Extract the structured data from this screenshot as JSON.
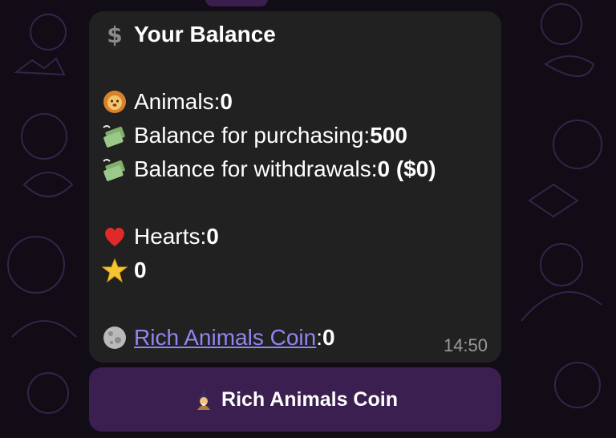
{
  "message": {
    "title": "Your Balance",
    "title_icon": "dollar-sign-icon",
    "animals_label": "Animals: ",
    "animals_value": "0",
    "animals_icon": "lion-face-icon",
    "purchase_label": "Balance for purchasing: ",
    "purchase_value": "500",
    "purchase_icon": "flying-money-icon",
    "withdraw_label": "Balance for withdrawals: ",
    "withdraw_value": "0 ($0)",
    "withdraw_icon": "flying-money-icon",
    "hearts_label": "Hearts: ",
    "hearts_value": "0",
    "hearts_icon": "red-heart-icon",
    "stars_value": "0",
    "stars_icon": "star-icon",
    "coin_link": "Rich Animals Coin",
    "coin_separator": ": ",
    "coin_value": "0",
    "coin_icon": "moon-coin-icon",
    "time": "14:50"
  },
  "keyboard": {
    "button_label": "Rich Animals Coin",
    "button_icon": "wizard-icon"
  },
  "colors": {
    "bubble_bg": "#212121",
    "button_bg": "#3b1f50",
    "link": "#8f86f0",
    "wallpaper": "#120c16"
  }
}
